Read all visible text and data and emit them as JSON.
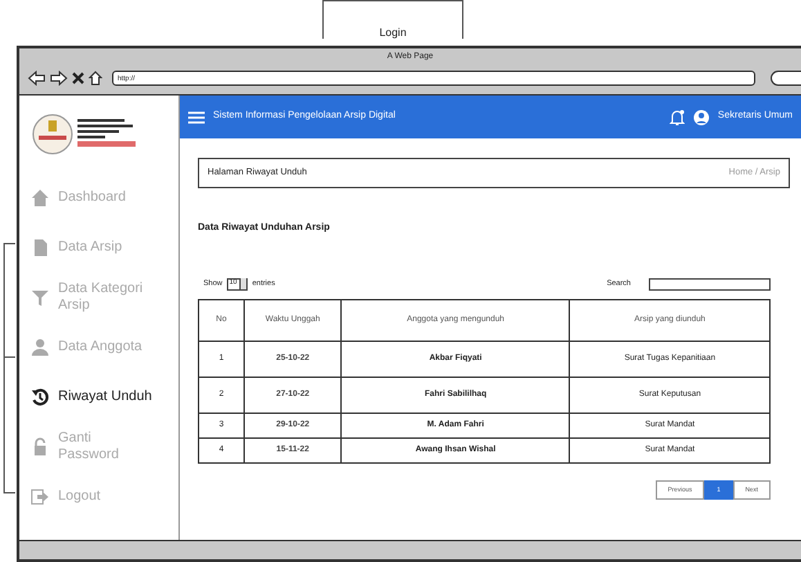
{
  "login_tab": {
    "label": "Login"
  },
  "browser": {
    "title": "A Web Page",
    "url": "http://"
  },
  "sidebar": {
    "items": [
      {
        "label": "Dashboard",
        "kind": "home",
        "selected": false
      },
      {
        "label": "Data Arsip",
        "kind": "file",
        "selected": false
      },
      {
        "label": "Data Kategori Arsip",
        "kind": "filter",
        "selected": false
      },
      {
        "label": "Data Anggota",
        "kind": "user",
        "selected": false
      },
      {
        "label": "Riwayat Unduh",
        "kind": "history",
        "selected": true
      },
      {
        "label": "Ganti Password",
        "kind": "lock",
        "selected": false
      },
      {
        "label": "Logout",
        "kind": "logout",
        "selected": false
      }
    ]
  },
  "header": {
    "title": "Sistem Informasi Pengelolaan Arsip Digital",
    "user": "Sekretaris Umum"
  },
  "breadcrumb": {
    "page": "Halaman Riwayat Unduh",
    "path": "Home / Arsip"
  },
  "section_title": "Data Riwayat Unduhan Arsip",
  "table_controls": {
    "show_label": "Show",
    "page_size": "10",
    "entries_label": "entries",
    "search_label": "Search"
  },
  "table": {
    "columns": [
      "No",
      "Waktu Unggah",
      "Anggota yang mengunduh",
      "Arsip yang diunduh"
    ],
    "rows": [
      [
        "1",
        "25-10-22",
        "Akbar Fiqyati",
        "Surat Tugas Kepanitiaan"
      ],
      [
        "2",
        "27-10-22",
        "Fahri Sabililhaq",
        "Surat Keputusan"
      ],
      [
        "3",
        "29-10-22",
        "M. Adam Fahri",
        "Surat Mandat"
      ],
      [
        "4",
        "15-11-22",
        "Awang Ihsan Wishal",
        "Surat Mandat"
      ]
    ]
  },
  "pagination": [
    {
      "label": "Previous",
      "selected": false
    },
    {
      "label": "1",
      "selected": true
    },
    {
      "label": "Next",
      "selected": false
    }
  ]
}
